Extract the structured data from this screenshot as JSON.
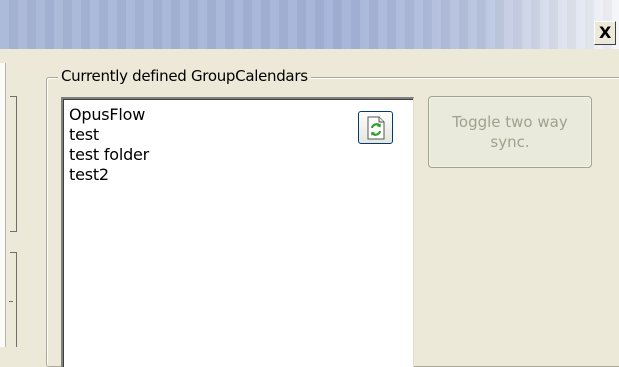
{
  "window": {
    "close_glyph": "X"
  },
  "groupbox": {
    "title": "Currently defined GroupCalendars"
  },
  "calendars": {
    "items": [
      "OpusFlow",
      "test",
      "test folder",
      "test2"
    ]
  },
  "refresh_button": {
    "icon": "refresh-document-icon",
    "accent_color": "#2e9f2e"
  },
  "toggle_button": {
    "label": "Toggle two way sync.",
    "enabled": false
  },
  "colors": {
    "title_bar": "#a3b2d8",
    "dialog_background": "#ece9d8",
    "disabled_text": "#a2a08d"
  }
}
